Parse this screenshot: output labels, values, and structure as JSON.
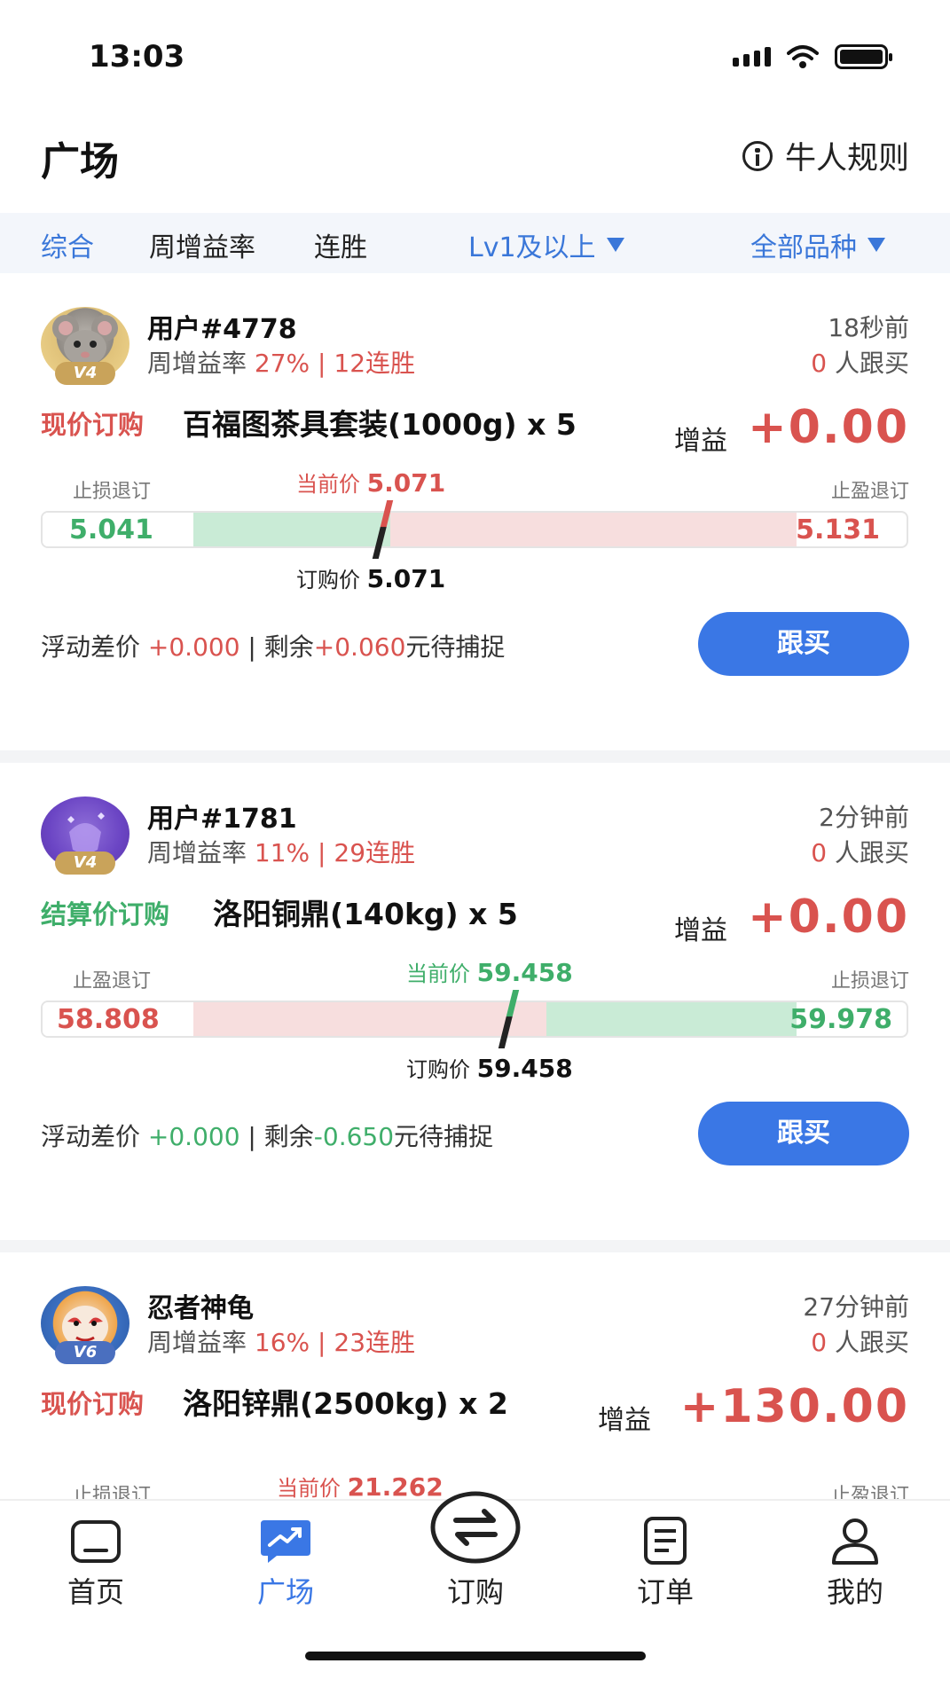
{
  "status_bar": {
    "time": "13:03"
  },
  "header": {
    "title": "广场",
    "rules_label": "牛人规则"
  },
  "filters": {
    "tabs": [
      "综合",
      "周增益率",
      "连胜"
    ],
    "level_filter": "Lv1及以上",
    "category_filter": "全部品种"
  },
  "cards": [
    {
      "user": "用户#4778",
      "level": "V4",
      "stats_prefix": "周增益率 ",
      "stats_value": "27% | 12连胜",
      "time_ago": "18秒前",
      "followers_count": "0",
      "followers_label": " 人跟买",
      "order_type": "现价订购",
      "product": "百福图茶具套装(1000g) x 5",
      "gain_label": "增益",
      "gain_value": "+0.00",
      "left_label": "止损退订",
      "right_label": "止盈退订",
      "current_label": "当前价",
      "current_price": "5.071",
      "left_value": "5.041",
      "right_value": "5.131",
      "buy_label": "订购价",
      "buy_price": "5.071",
      "float_label": "浮动差价 ",
      "float_value": "+0.000",
      "remain_label": " | 剩余",
      "remain_value": "+0.060",
      "remain_suffix": "元待捕捉",
      "follow_label": "跟买"
    },
    {
      "user": "用户#1781",
      "level": "V4",
      "stats_prefix": "周增益率 ",
      "stats_value": "11% | 29连胜",
      "time_ago": "2分钟前",
      "followers_count": "0",
      "followers_label": " 人跟买",
      "order_type": "结算价订购",
      "product": "洛阳铜鼎(140kg) x 5",
      "gain_label": "增益",
      "gain_value": "+0.00",
      "left_label": "止盈退订",
      "right_label": "止损退订",
      "current_label": "当前价",
      "current_price": "59.458",
      "left_value": "58.808",
      "right_value": "59.978",
      "buy_label": "订购价",
      "buy_price": "59.458",
      "float_label": "浮动差价 ",
      "float_value": "+0.000",
      "remain_label": " | 剩余",
      "remain_value": "-0.650",
      "remain_suffix": "元待捕捉",
      "follow_label": "跟买"
    },
    {
      "user": "忍者神龟",
      "level": "V6",
      "stats_prefix": "周增益率 ",
      "stats_value": "16% | 23连胜",
      "time_ago": "27分钟前",
      "followers_count": "0",
      "followers_label": " 人跟买",
      "order_type": "现价订购",
      "product": "洛阳锌鼎(2500kg) x 2",
      "gain_label": "增益",
      "gain_value": "+130.00",
      "left_label": "止损退订",
      "right_label": "止盈退订",
      "current_label": "当前价",
      "current_price": "21.262"
    }
  ],
  "tab_bar": {
    "items": [
      {
        "label": "首页",
        "icon": "home-icon"
      },
      {
        "label": "广场",
        "icon": "trend-chart-icon"
      },
      {
        "label": "订购",
        "icon": "swap-icon"
      },
      {
        "label": "订单",
        "icon": "document-icon"
      },
      {
        "label": "我的",
        "icon": "person-icon"
      }
    ],
    "active": "广场"
  },
  "colors": {
    "accent": "#3a77e5",
    "gain_red": "#d9534f",
    "loss_green": "#3fae6a",
    "bar_red": "#f7dede",
    "bar_green": "#c9ebd6"
  }
}
